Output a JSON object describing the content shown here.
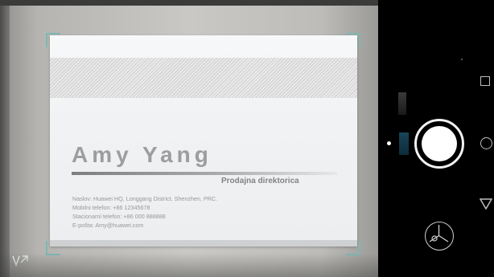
{
  "card": {
    "name": "Amy Yang",
    "role": "Prodajna direktorica",
    "address": "Naslov: Huawei HQ, Longgang District, Shenzhen, PRC.",
    "mobile": "Mobilni telefon: +86 12345678",
    "landline": "Stacionarni telefon: +86 000 888888",
    "email": "E-pošta: Amy@huawei.com"
  },
  "icons": {
    "hdr": "hdr-off-icon",
    "shutter": "shutter-icon",
    "gallery": "gallery-thumbnail-icon",
    "recent": "recent-apps-icon",
    "home": "home-icon",
    "back": "back-icon"
  },
  "colors": {
    "focus_corner": "#7fb7b3",
    "panel": "#000000",
    "shutter": "#ffffff"
  }
}
